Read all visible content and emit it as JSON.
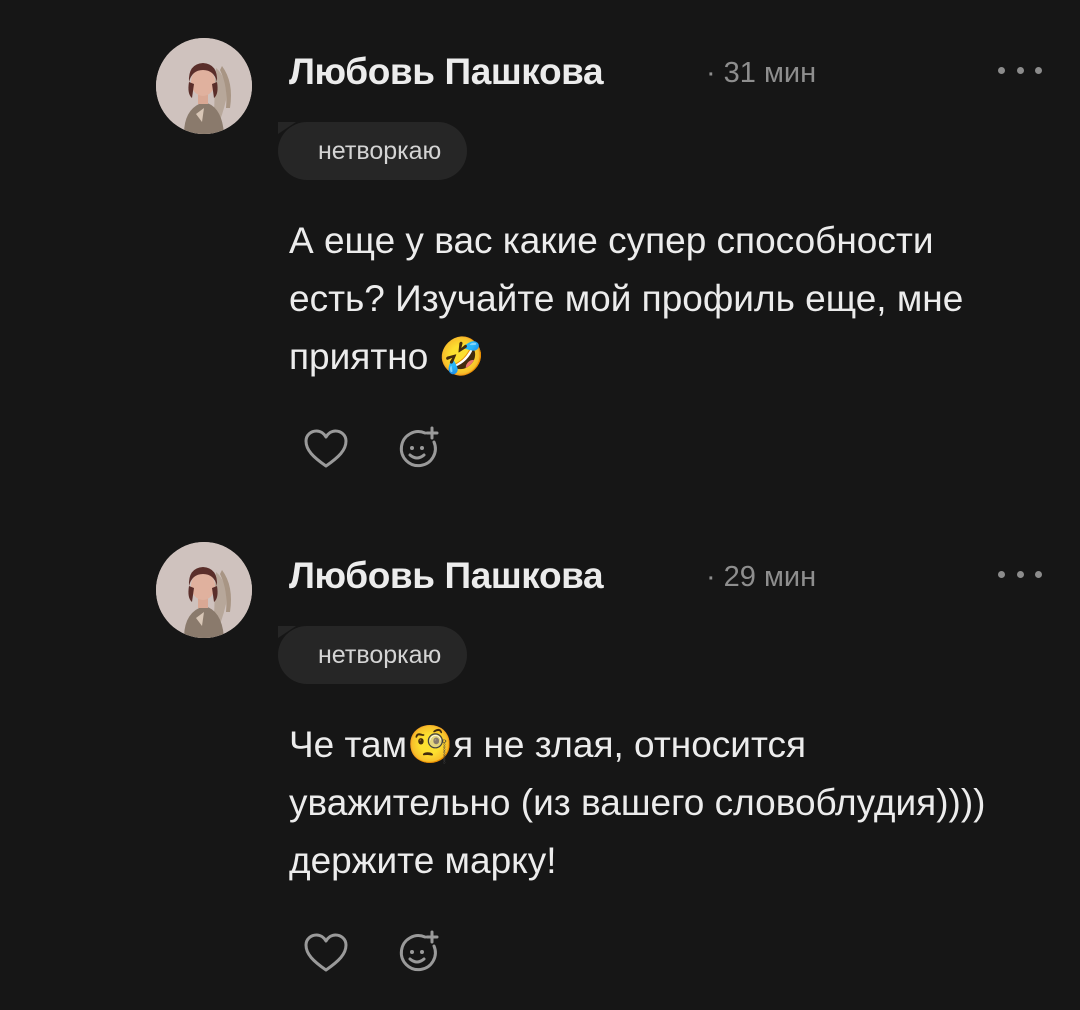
{
  "comments": [
    {
      "author": "Любовь Пашкова",
      "time": "31 мин",
      "dot": "·",
      "tag": "нетворкаю",
      "text": "А еще у вас какие супер способности есть? Изучайте мой профиль еще, мне приятно 🤣"
    },
    {
      "author": "Любовь Пашкова",
      "time": "29 мин",
      "dot": "·",
      "tag": "нетворкаю",
      "text": "Че там🧐я не злая, относится уважительно (из вашего словоблудия)))) держите марку!"
    }
  ],
  "icons": {
    "like": "heart-icon",
    "react": "emoji-add-icon",
    "more": "more-dots-icon"
  },
  "colors": {
    "background": "#161616",
    "text": "#ececec",
    "muted": "#8e8e8e",
    "tag_bg": "#262626"
  }
}
